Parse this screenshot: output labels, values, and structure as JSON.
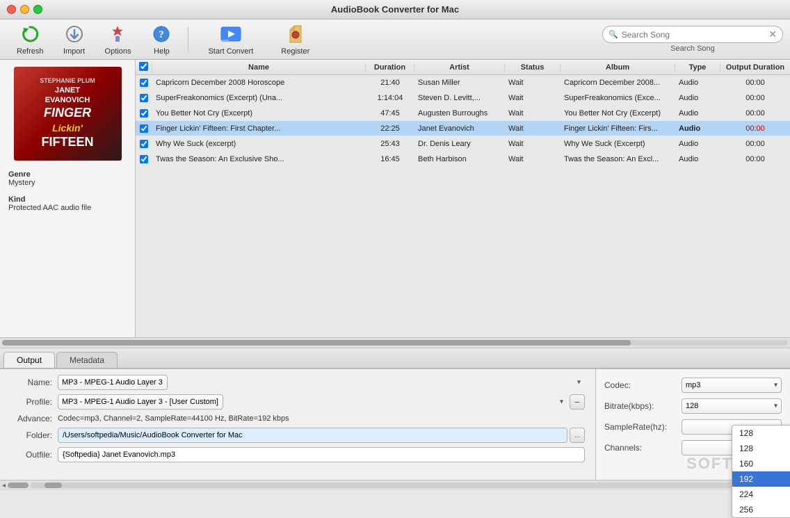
{
  "window": {
    "title": "AudioBook Converter for Mac"
  },
  "toolbar": {
    "refresh_label": "Refresh",
    "import_label": "Import",
    "options_label": "Options",
    "help_label": "Help",
    "start_convert_label": "Start Convert",
    "register_label": "Register",
    "search_placeholder": "Search Song",
    "search_label": "Search Song"
  },
  "table": {
    "headers": [
      "",
      "Name",
      "Duration",
      "Artist",
      "Status",
      "Album",
      "Type",
      "Output Duration"
    ],
    "rows": [
      {
        "checked": true,
        "name": "Capricorn December 2008 Horoscope",
        "duration": "21:40",
        "artist": "Susan Miller",
        "status": "Wait",
        "album": "Capricorn December 2008...",
        "type": "Audio",
        "output_duration": "00:00",
        "selected": false
      },
      {
        "checked": true,
        "name": "SuperFreakonomics (Excerpt) (Una...",
        "duration": "1:14:04",
        "artist": "Steven D. Levitt,...",
        "status": "Wait",
        "album": "SuperFreakonomics (Exce...",
        "type": "Audio",
        "output_duration": "00:00",
        "selected": false
      },
      {
        "checked": true,
        "name": "You Better Not Cry (Excerpt)",
        "duration": "47:45",
        "artist": "Augusten Burroughs",
        "status": "Wait",
        "album": "You Better Not Cry (Excerpt)",
        "type": "Audio",
        "output_duration": "00:00",
        "selected": false
      },
      {
        "checked": true,
        "name": "Finger Lickin' Fifteen: First Chapter...",
        "duration": "22:25",
        "artist": "Janet Evanovich",
        "status": "Wait",
        "album": "Finger Lickin' Fifteen: Firs...",
        "type": "Audio",
        "output_duration": "00:00",
        "selected": true
      },
      {
        "checked": true,
        "name": "Why We Suck (excerpt)",
        "duration": "25:43",
        "artist": "Dr. Denis Leary",
        "status": "Wait",
        "album": "Why We Suck (Excerpt)",
        "type": "Audio",
        "output_duration": "00:00",
        "selected": false
      },
      {
        "checked": true,
        "name": "Twas the Season: An Exclusive Sho...",
        "duration": "16:45",
        "artist": "Beth Harbison",
        "status": "Wait",
        "album": "Twas the Season: An Excl...",
        "type": "Audio",
        "output_duration": "00:00",
        "selected": false
      }
    ]
  },
  "left_panel": {
    "album_artist": "JANET",
    "album_name": "EVANOVICH",
    "album_series": "FINGER",
    "album_subtitle": "Lickin'",
    "album_number": "FIFTEEN",
    "genre_label": "Genre",
    "genre_value": "Mystery",
    "kind_label": "Kind",
    "kind_value": "Protected AAC audio file"
  },
  "tabs": [
    {
      "id": "output",
      "label": "Output",
      "active": true
    },
    {
      "id": "metadata",
      "label": "Metadata",
      "active": false
    }
  ],
  "bottom_form": {
    "name_label": "Name:",
    "name_value": "MP3 - MPEG-1 Audio Layer 3",
    "profile_label": "Profile:",
    "profile_value": "MP3 - MPEG-1 Audio Layer 3 - [User Custom]",
    "advance_label": "Advance:",
    "advance_value": "Codec=mp3, Channel=2, SampleRate=44100 Hz, BitRate=192 kbps",
    "folder_label": "Folder:",
    "folder_value": "/Users/softpedia/Music/AudioBook Converter for Mac",
    "outfile_label": "Outfile:",
    "outfile_value": "{Softpedia} Janet Evanovich.mp3"
  },
  "codec_panel": {
    "codec_label": "Codec:",
    "codec_value": "mp3",
    "bitrate_label": "Bitrate(kbps):",
    "bitrate_value": "128",
    "samplerate_label": "SampleRate(hz):",
    "samplerate_value": "",
    "channels_label": "Channels:",
    "channels_value": ""
  },
  "bitrate_dropdown": {
    "options": [
      {
        "value": "128",
        "label": "128"
      },
      {
        "value": "128b",
        "label": "128"
      },
      {
        "value": "160",
        "label": "160"
      },
      {
        "value": "192",
        "label": "192",
        "selected": true
      },
      {
        "value": "224",
        "label": "224"
      },
      {
        "value": "256",
        "label": "256"
      }
    ]
  }
}
